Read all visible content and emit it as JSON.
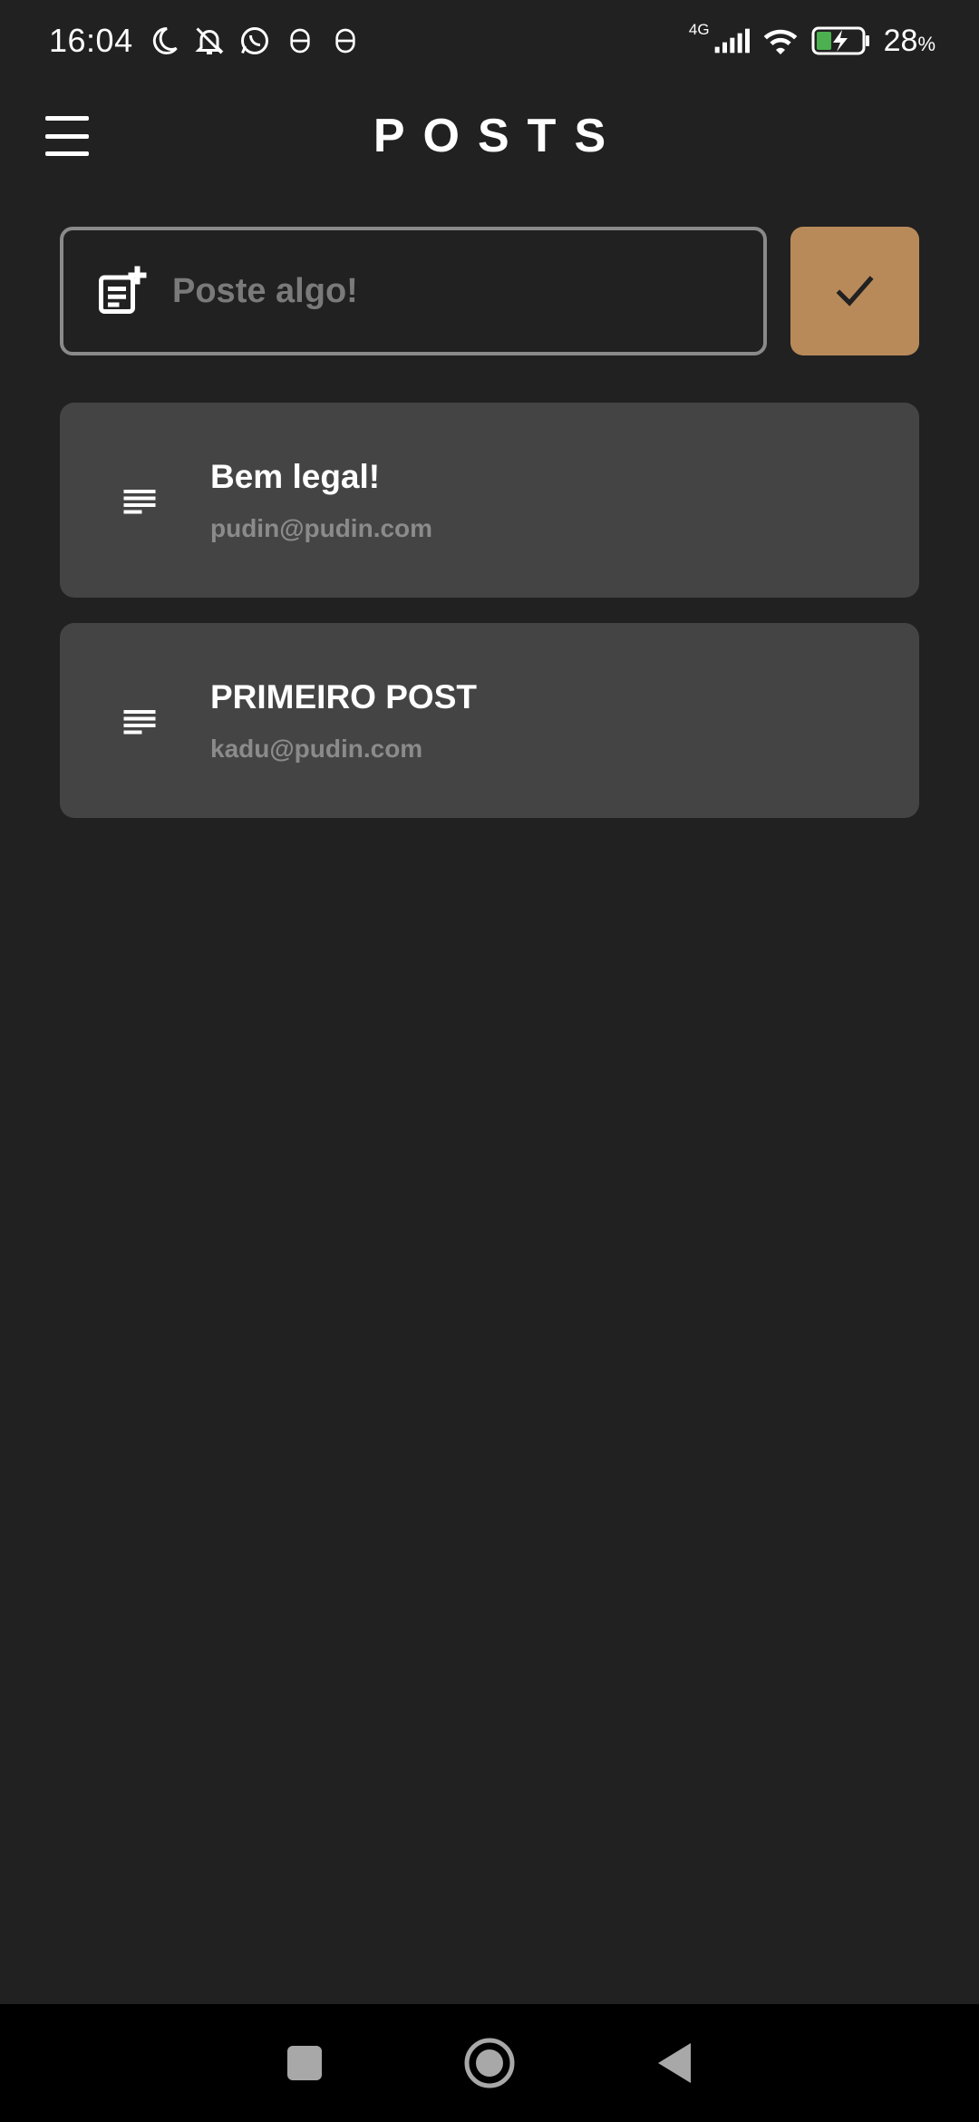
{
  "status_bar": {
    "time": "16:04",
    "network": "4G",
    "battery_percent": "28",
    "battery_unit": "%",
    "left_icons": [
      "moon-icon",
      "bell-off-icon",
      "whatsapp-icon",
      "notification-icon",
      "notification-icon"
    ],
    "right_icons": [
      "signal-icon",
      "wifi-icon",
      "battery-charging-icon"
    ]
  },
  "app_bar": {
    "title": "POSTS",
    "menu_icon": "hamburger-menu-icon"
  },
  "composer": {
    "placeholder": "Poste algo!",
    "value": "",
    "icon": "post-add-icon",
    "submit_icon": "check-icon"
  },
  "posts": [
    {
      "title": "Bem legal!",
      "author": "pudin@pudin.com",
      "icon": "notes-icon"
    },
    {
      "title": "PRIMEIRO POST",
      "author": "kadu@pudin.com",
      "icon": "notes-icon"
    }
  ],
  "nav_bar": {
    "buttons": [
      "recents-icon",
      "home-icon",
      "back-icon"
    ]
  },
  "colors": {
    "background": "#212121",
    "card": "#444444",
    "accent": "#b88a5a",
    "muted_text": "#8b8b8b",
    "battery_fill": "#4caf50"
  }
}
